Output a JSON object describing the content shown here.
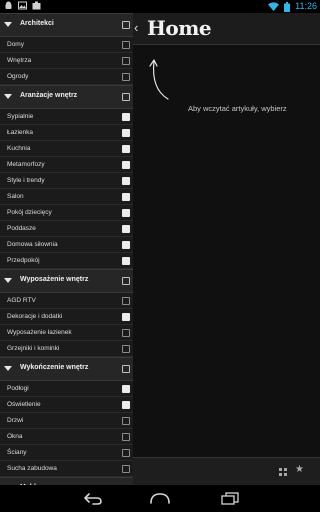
{
  "status_bar": {
    "time": "11:26",
    "left_icons": [
      "android-notification-icon",
      "gallery-notification-icon",
      "download-notification-icon"
    ],
    "right_icons": [
      "wifi-icon",
      "battery-icon"
    ],
    "accent_color": "#33b5e5"
  },
  "drawer": {
    "categories": [
      {
        "label": "Architekci",
        "checked": false,
        "items": [
          {
            "label": "Domy",
            "checked": false
          },
          {
            "label": "Wnętrza",
            "checked": false
          },
          {
            "label": "Ogrody",
            "checked": false
          }
        ]
      },
      {
        "label": "Aranżacje wnętrz",
        "checked": true,
        "items": [
          {
            "label": "Sypialnie",
            "checked": true
          },
          {
            "label": "Łazienka",
            "checked": true
          },
          {
            "label": "Kuchnia",
            "checked": true
          },
          {
            "label": "Metamorfozy",
            "checked": true
          },
          {
            "label": "Style i trendy",
            "checked": true
          },
          {
            "label": "Salon",
            "checked": true
          },
          {
            "label": "Pokój dziecięcy",
            "checked": true
          },
          {
            "label": "Poddasze",
            "checked": true
          },
          {
            "label": "Domowa siłownia",
            "checked": true
          },
          {
            "label": "Przedpokój",
            "checked": true
          }
        ]
      },
      {
        "label": "Wyposażenie wnętrz",
        "checked": false,
        "items": [
          {
            "label": "AGD RTV",
            "checked": false
          },
          {
            "label": "Dekoracje i dodatki",
            "checked": true
          },
          {
            "label": "Wyposażenie łazienek",
            "checked": false
          },
          {
            "label": "Grzejniki i kominki",
            "checked": false
          }
        ]
      },
      {
        "label": "Wykończenie wnętrz",
        "checked": false,
        "items": [
          {
            "label": "Podłogi",
            "checked": true
          },
          {
            "label": "Oświetlenie",
            "checked": true
          },
          {
            "label": "Drzwi",
            "checked": false
          },
          {
            "label": "Okna",
            "checked": false
          },
          {
            "label": "Ściany",
            "checked": false
          },
          {
            "label": "Sucha zabudowa",
            "checked": false
          }
        ]
      },
      {
        "label": "Meble",
        "checked": false,
        "items": []
      }
    ]
  },
  "main": {
    "title": "Home",
    "message": "Aby wczytać artykuły, wybierz",
    "bottom_icons": [
      "grid-view-icon",
      "star-icon"
    ]
  },
  "nav_bar": {
    "buttons": [
      "back",
      "home",
      "recent-apps"
    ]
  }
}
